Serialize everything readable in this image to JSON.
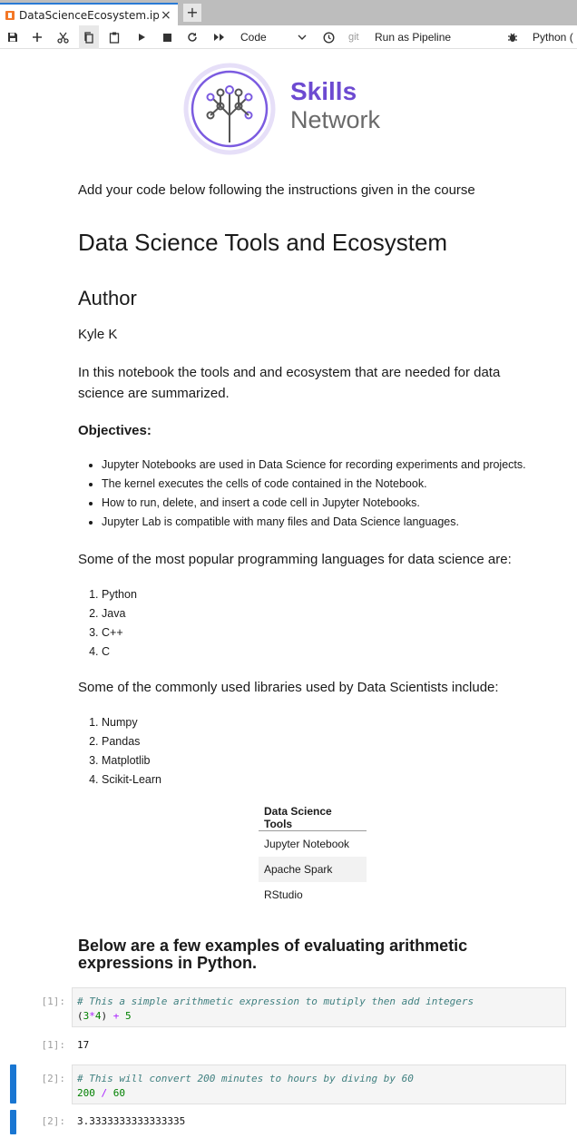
{
  "tab": {
    "title": "DataScienceEcosystem.ipyn",
    "close": "×",
    "new": "+"
  },
  "toolbar": {
    "cell_type": "Code",
    "git": "git",
    "run_pipeline": "Run as Pipeline",
    "kernel": "Python ("
  },
  "logo": {
    "line1": "Skills",
    "line2": "Network"
  },
  "notebook": {
    "intro": "Add your code below following the instructions given in the course",
    "title": "Data Science Tools and Ecosystem",
    "author_heading": "Author",
    "author_name": "Kyle K",
    "summary_line1": "In this notebook the tools and and ecosystem that are needed for data",
    "summary_line2": "science are summarized.",
    "objectives_heading": "Objectives:",
    "objectives": [
      "Jupyter Notebooks are used in Data Science for recording experiments and projects.",
      "The kernel executes the cells of code contained in the Notebook.",
      "How to run, delete, and insert a code cell in Jupyter Notebooks.",
      "Jupyter Lab is compatible with many files and Data Science languages."
    ],
    "languages_intro": "Some of the most popular programming languages for data science are:",
    "languages": [
      "Python",
      "Java",
      "C++",
      "C"
    ],
    "libraries_intro": "Some of the commonly used libraries used by Data Scientists include:",
    "libraries": [
      "Numpy",
      "Pandas",
      "Matplotlib",
      "Scikit-Learn"
    ],
    "tools_table": {
      "header": "Data Science Tools",
      "rows": [
        "Jupyter Notebook",
        "Apache Spark",
        "RStudio"
      ]
    },
    "arith_heading_line1": "Below are a few examples of evaluating arithmetic",
    "arith_heading_line2": "expressions in Python."
  },
  "cells": [
    {
      "prompt_in": "[1]:",
      "comment": "# This a simple arithmetic expression to mutiply then add integers",
      "code": [
        "(",
        "3",
        "*",
        "4",
        ") ",
        "+",
        " ",
        "5"
      ],
      "prompt_out": "[1]:",
      "output": "17"
    },
    {
      "prompt_in": "[2]:",
      "comment": "# This will convert 200 minutes to hours by diving by 60",
      "code": [
        "200",
        " ",
        "/",
        " ",
        "60"
      ],
      "prompt_out": "[2]:",
      "output": "3.3333333333333335"
    }
  ],
  "colors": {
    "accent": "#1976d2",
    "brand_purple": "#6d4ad1"
  }
}
